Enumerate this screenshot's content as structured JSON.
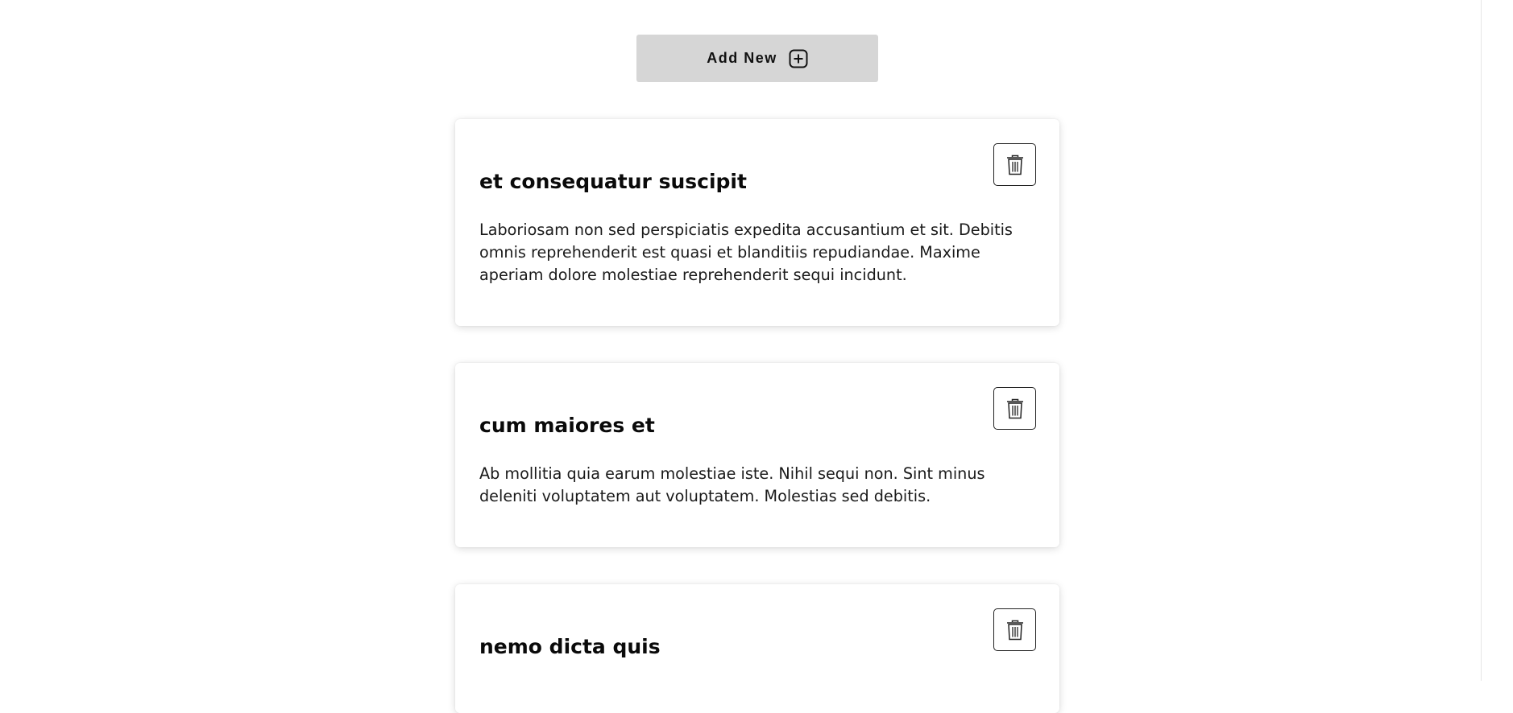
{
  "toolbar": {
    "add_label": "Add New",
    "add_icon": "plus-square-icon"
  },
  "cards": [
    {
      "title": "et consequatur suscipit",
      "body": "Laboriosam non sed perspiciatis expedita accusantium et sit. Debitis omnis reprehenderit est quasi et blanditiis repudiandae. Maxime aperiam dolore molestiae reprehenderit sequi incidunt.",
      "delete_icon": "trash-icon"
    },
    {
      "title": "cum maiores et",
      "body": "Ab mollitia quia earum molestiae iste. Nihil sequi non. Sint minus deleniti voluptatem aut voluptatem. Molestias sed debitis.",
      "delete_icon": "trash-icon"
    },
    {
      "title": "nemo dicta quis",
      "body": "",
      "delete_icon": "trash-icon"
    }
  ],
  "colors": {
    "add_button_bg": "#d6d6d6",
    "card_bg": "#ffffff",
    "text": "#111111"
  }
}
